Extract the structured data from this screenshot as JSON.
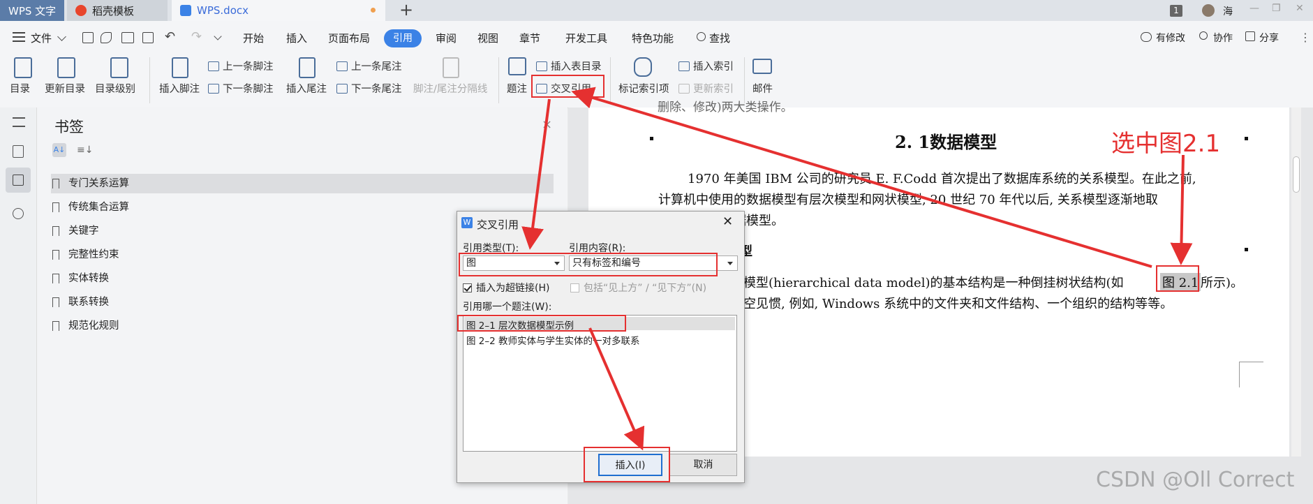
{
  "titlebar": {
    "tabs": [
      {
        "label": "WPS 文字"
      },
      {
        "label": "稻壳模板"
      },
      {
        "label": "WPS.docx"
      }
    ],
    "new_tab": "+",
    "badge": "1",
    "user": "海",
    "window_controls": [
      "—",
      "❐",
      "✕"
    ]
  },
  "menubar": {
    "file": "文件",
    "items": [
      "开始",
      "插入",
      "页面布局",
      "引用",
      "审阅",
      "视图",
      "章节",
      "开发工具",
      "特色功能"
    ],
    "search": "查找",
    "right": [
      "有修改",
      "协作",
      "分享"
    ]
  },
  "ribbon": {
    "toc": "目录",
    "update_toc": "更新目录",
    "toc_level": "目录级别",
    "insert_footnote": "插入脚注",
    "prev_footnote": "上一条脚注",
    "next_footnote": "下一条脚注",
    "insert_endnote": "插入尾注",
    "prev_endnote": "上一条尾注",
    "next_endnote": "下一条尾注",
    "separator": "脚注/尾注分隔线",
    "caption": "题注",
    "insert_table_of_figures": "插入表目录",
    "cross_reference": "交叉引用",
    "mark_index": "标记索引项",
    "insert_index": "插入索引",
    "update_index": "更新索引",
    "mail": "邮件"
  },
  "bookmarks": {
    "title": "书签",
    "items": [
      "专门关系运算",
      "传统集合运算",
      "关键字",
      "完整性约束",
      "实体转换",
      "联系转换",
      "规范化规则"
    ]
  },
  "document": {
    "line0": "删除、修改)两大类操作。",
    "heading": "2. 1数据模型",
    "annotation": "选中图2.1",
    "para1_l1": "1970 年美国 IBM 公司的研究员 E. F.Codd 首次提出了数据库系统的关系模型。在此之前,",
    "para1_l2": "计算机中使用的数据模型有层次模型和网状模型, 20 世纪 70 年代以后, 关系模型逐渐地取",
    "para1_l3": "代了这两种数据模型。",
    "sub_heading": "型",
    "para2_l1": "模型(hierarchical data model)的基本结构是一种倒挂树状结构(如",
    "figref": "图 2.1",
    "para2_tail": "所示)。",
    "para2_l2": "空见惯, 例如, Windows 系统中的文件夹和文件结构、一个组织的结构等等。"
  },
  "dialog": {
    "title": "交叉引用",
    "ref_type_label": "引用类型(T):",
    "ref_type_value": "图",
    "ref_content_label": "引用内容(R):",
    "ref_content_value": "只有标签和编号",
    "hyperlink": "插入为超链接(H)",
    "include_above_below": "包括“见上方” / “见下方”(N)",
    "which_caption": "引用哪一个题注(W):",
    "captions": [
      "图 2–1 层次数据模型示例",
      "图 2–2 教师实体与学生实体的一对多联系"
    ],
    "insert": "插入(I)",
    "cancel": "取消"
  },
  "watermark": "CSDN @Oll Correct",
  "colors": {
    "accent": "#3b82e6",
    "annotation": "#e53030"
  }
}
